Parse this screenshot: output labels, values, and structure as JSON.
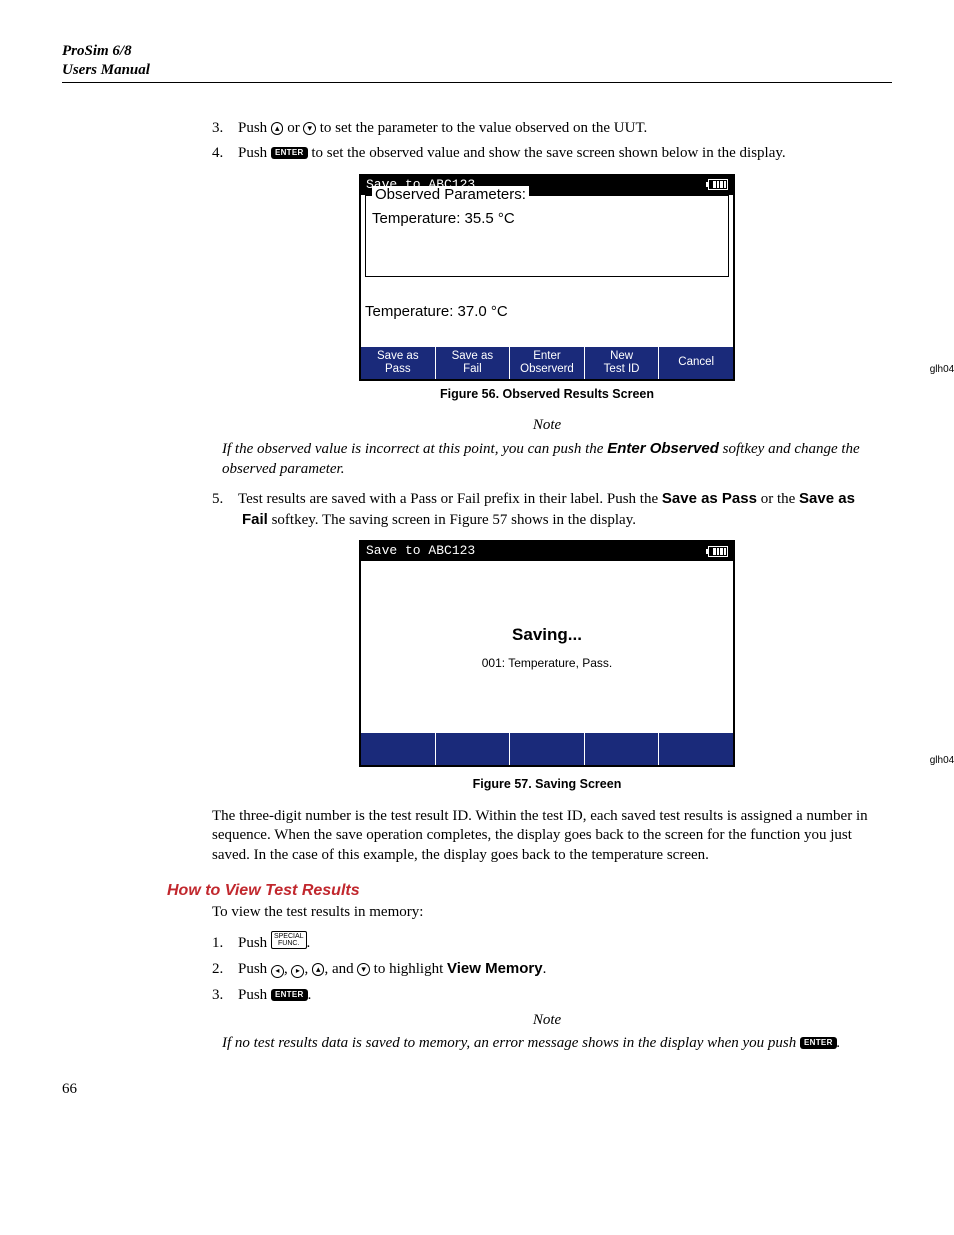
{
  "header": {
    "line1": "ProSim 6/8",
    "line2": "Users Manual"
  },
  "steps_a": {
    "s3": {
      "num": "3.",
      "t1": "Push ",
      "t2": " or ",
      "t3": " to set the parameter to the value observed on the UUT."
    },
    "s4": {
      "num": "4.",
      "t1": "Push ",
      "t2": " to set the observed value and show the save screen shown below in the display."
    }
  },
  "fig56": {
    "title": "Save to ABC123",
    "legend": "Observed Parameters:",
    "line1": "Temperature: 35.5 °C",
    "line2": "Temperature: 37.0 °C",
    "softkeys": [
      "Save as\nPass",
      "Save as\nFail",
      "Enter\nObserverd",
      "New\nTest ID",
      "Cancel"
    ],
    "bmp": "glh049.bmp",
    "caption": "Figure 56. Observed Results Screen"
  },
  "note1": {
    "head": "Note",
    "body_a": "If the observed value is incorrect at this point, you can push the ",
    "bold": "Enter Observed",
    "body_b": " softkey and change the observed parameter."
  },
  "step5": {
    "num": "5.",
    "t1": "Test results are saved with a Pass or Fail prefix in their label. Push the ",
    "b1": "Save as Pass",
    "t2": " or the ",
    "b2": "Save as Fail",
    "t3": " softkey. The saving screen in Figure 57 shows in the display."
  },
  "fig57": {
    "title": "Save to ABC123",
    "big": "Saving...",
    "small": "001: Temperature, Pass.",
    "bmp": "glh040.bmp",
    "caption": "Figure 57. Saving Screen"
  },
  "para1": "The three-digit number is the test result ID. Within the test ID, each saved test results is assigned a number in sequence. When the save operation completes, the display goes back to the screen for the function you just saved. In the case of this example, the display goes back to the temperature screen.",
  "h2": "How to View Test Results",
  "para2": "To view the test results in memory:",
  "steps_b": {
    "s1": {
      "num": "1.",
      "t1": "Push ",
      "key": "SPECIAL\nFUNC.",
      "t2": "."
    },
    "s2": {
      "num": "2.",
      "t1": "Push ",
      "t2": ", ",
      "t3": ", ",
      "t4": ", and ",
      "t5": " to highlight ",
      "b": "View Memory",
      "t6": "."
    },
    "s3": {
      "num": "3.",
      "t1": "Push ",
      "t2": "."
    }
  },
  "note2": {
    "head": "Note",
    "body_a": "If no test results data is saved to memory, an error message shows in the display when you push ",
    "body_b": "."
  },
  "keys": {
    "enter": "ENTER"
  },
  "page": "66"
}
